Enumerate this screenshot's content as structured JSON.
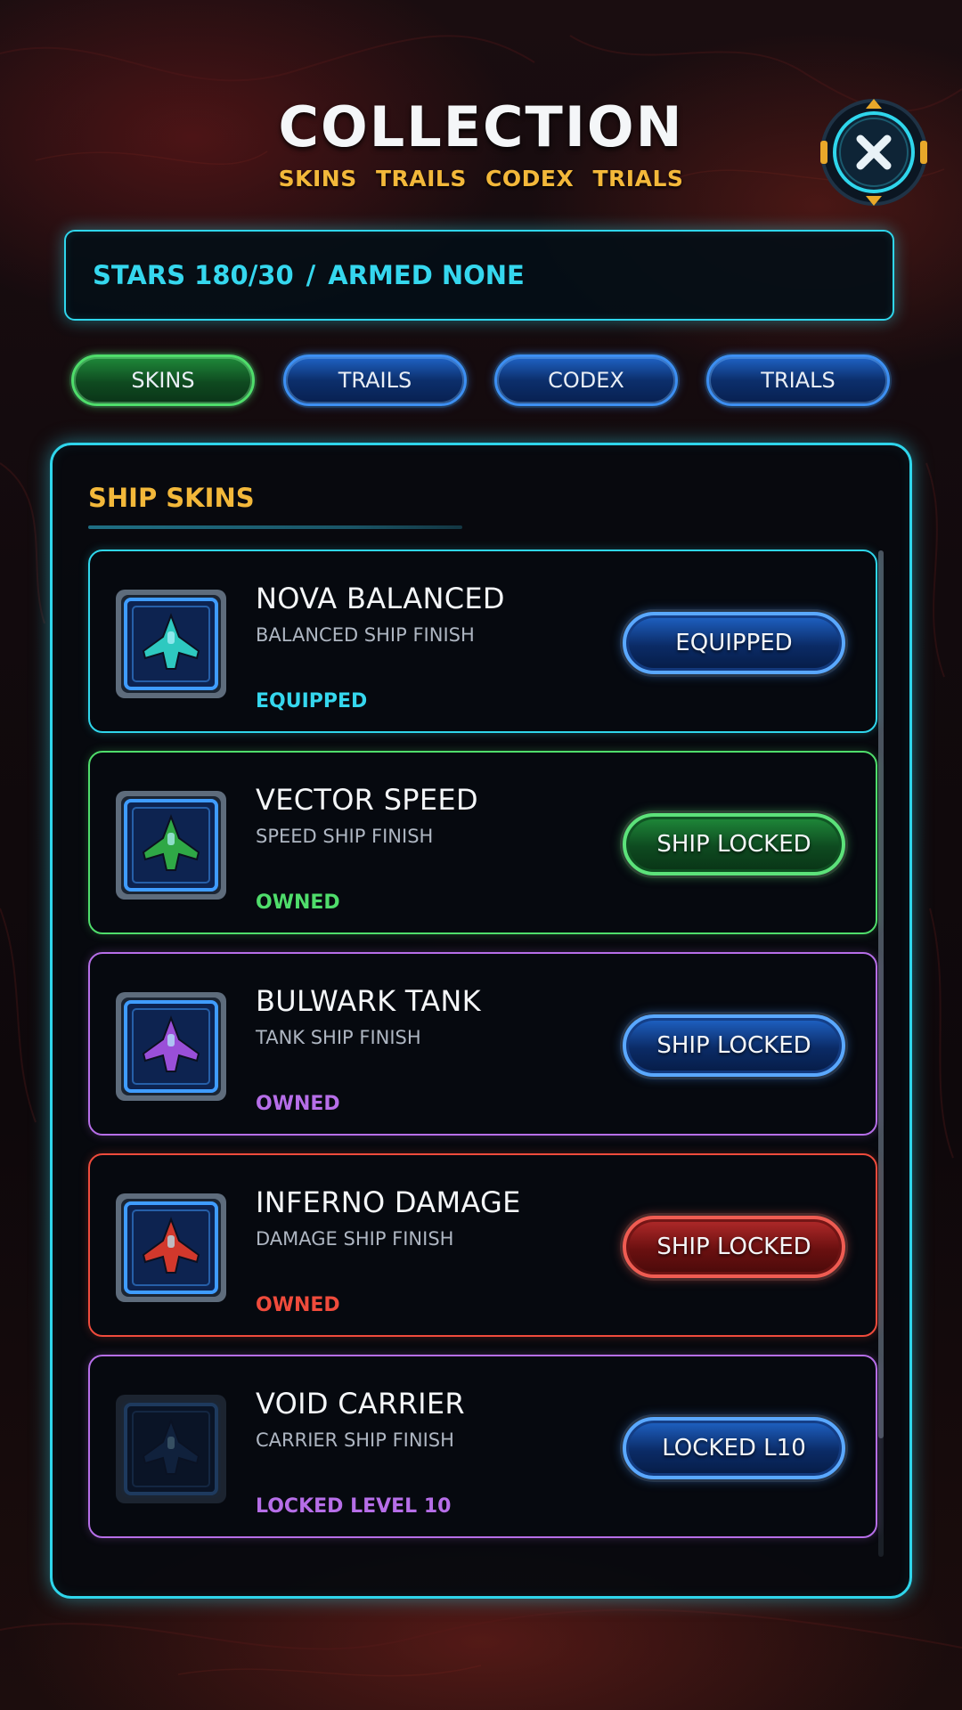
{
  "header": {
    "title": "COLLECTION",
    "subnav": [
      "SKINS",
      "TRAILS",
      "CODEX",
      "TRIALS"
    ]
  },
  "close_button": {
    "icon": "close-icon"
  },
  "stats": {
    "stars": "STARS 180/30",
    "separator": "/",
    "armed": "ARMED NONE"
  },
  "tabs": [
    {
      "label": "SKINS",
      "active": true
    },
    {
      "label": "TRAILS",
      "active": false
    },
    {
      "label": "CODEX",
      "active": false
    },
    {
      "label": "TRIALS",
      "active": false
    }
  ],
  "panel": {
    "title": "SHIP SKINS"
  },
  "skins": [
    {
      "name": "NOVA BALANCED",
      "description": "BALANCED SHIP FINISH",
      "status": "EQUIPPED",
      "action": "EQUIPPED",
      "accent": "#2fd6ec",
      "action_style": "blue",
      "ship_color": "#2ec9c0",
      "icon": "ship-nova-icon"
    },
    {
      "name": "VECTOR SPEED",
      "description": "SPEED SHIP FINISH",
      "status": "OWNED",
      "action": "SHIP LOCKED",
      "accent": "#4fdd6b",
      "action_style": "green",
      "ship_color": "#2fa846",
      "icon": "ship-vector-icon"
    },
    {
      "name": "BULWARK TANK",
      "description": "TANK SHIP FINISH",
      "status": "OWNED",
      "action": "SHIP LOCKED",
      "accent": "#b66ee8",
      "action_style": "blue",
      "ship_color": "#9a4fd8",
      "icon": "ship-bulwark-icon"
    },
    {
      "name": "INFERNO DAMAGE",
      "description": "DAMAGE SHIP FINISH",
      "status": "OWNED",
      "action": "SHIP LOCKED",
      "accent": "#ef4b3c",
      "action_style": "red",
      "ship_color": "#d2382c",
      "icon": "ship-inferno-icon"
    },
    {
      "name": "VOID CARRIER",
      "description": "CARRIER SHIP FINISH",
      "status": "LOCKED LEVEL 10",
      "action": "LOCKED L10",
      "accent": "#b66ee8",
      "action_style": "blue",
      "ship_color": "#1d3a66",
      "icon": "ship-void-icon",
      "locked": true
    }
  ]
}
